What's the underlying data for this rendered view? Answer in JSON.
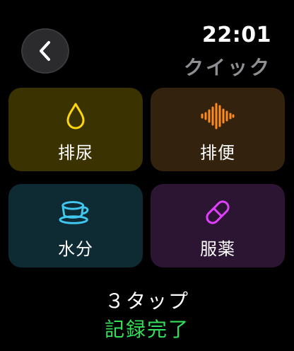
{
  "header": {
    "time": "22:01",
    "title": "クイック",
    "back_icon": "chevron-left-icon"
  },
  "tiles": [
    {
      "label": "排尿",
      "icon": "drop-icon",
      "color": "#ffd60a",
      "background": "#3a3200"
    },
    {
      "label": "排便",
      "icon": "waveform-icon",
      "color": "#ff8c1a",
      "background": "#33220d"
    },
    {
      "label": "水分",
      "icon": "cup-icon",
      "color": "#40c8f0",
      "background": "#0e2a33"
    },
    {
      "label": "服薬",
      "icon": "pill-icon",
      "color": "#e040fb",
      "background": "#2c1433"
    }
  ],
  "footer": {
    "line1": "３タップ",
    "line2": "記録完了",
    "line2_color": "#34e05a"
  }
}
